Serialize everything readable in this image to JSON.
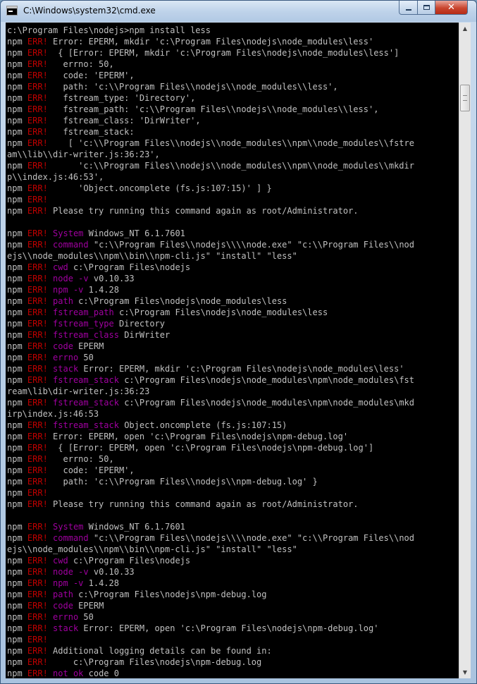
{
  "window": {
    "title": "C:\\Windows\\system32\\cmd.exe",
    "icon": "cmd-icon",
    "controls": {
      "minimize": "minimize-icon",
      "maximize": "maximize-icon",
      "close": "✕"
    }
  },
  "colors": {
    "background": "#000000",
    "text": "#c0c0c0",
    "err": "#c00000",
    "key": "#a000a0"
  },
  "console": {
    "lines": [
      [
        [
          "c:\\Program Files\\nodejs>npm install less",
          ""
        ]
      ],
      [
        [
          "npm ",
          ""
        ],
        [
          "ERR!",
          "r"
        ],
        [
          " Error: EPERM, mkdir 'c:\\Program Files\\nodejs\\node_modules\\less'",
          ""
        ]
      ],
      [
        [
          "npm ",
          ""
        ],
        [
          "ERR!",
          "r"
        ],
        [
          "  { [Error: EPERM, mkdir 'c:\\Program Files\\nodejs\\node_modules\\less']",
          ""
        ]
      ],
      [
        [
          "npm ",
          ""
        ],
        [
          "ERR!",
          "r"
        ],
        [
          "   errno: 50,",
          ""
        ]
      ],
      [
        [
          "npm ",
          ""
        ],
        [
          "ERR!",
          "r"
        ],
        [
          "   code: 'EPERM',",
          ""
        ]
      ],
      [
        [
          "npm ",
          ""
        ],
        [
          "ERR!",
          "r"
        ],
        [
          "   path: 'c:\\\\Program Files\\\\nodejs\\\\node_modules\\\\less',",
          ""
        ]
      ],
      [
        [
          "npm ",
          ""
        ],
        [
          "ERR!",
          "r"
        ],
        [
          "   fstream_type: 'Directory',",
          ""
        ]
      ],
      [
        [
          "npm ",
          ""
        ],
        [
          "ERR!",
          "r"
        ],
        [
          "   fstream_path: 'c:\\\\Program Files\\\\nodejs\\\\node_modules\\\\less',",
          ""
        ]
      ],
      [
        [
          "npm ",
          ""
        ],
        [
          "ERR!",
          "r"
        ],
        [
          "   fstream_class: 'DirWriter',",
          ""
        ]
      ],
      [
        [
          "npm ",
          ""
        ],
        [
          "ERR!",
          "r"
        ],
        [
          "   fstream_stack:",
          ""
        ]
      ],
      [
        [
          "npm ",
          ""
        ],
        [
          "ERR!",
          "r"
        ],
        [
          "    [ 'c:\\\\Program Files\\\\nodejs\\\\node_modules\\\\npm\\\\node_modules\\\\fstre",
          ""
        ]
      ],
      [
        [
          "am\\\\lib\\\\dir-writer.js:36:23',",
          ""
        ]
      ],
      [
        [
          "npm ",
          ""
        ],
        [
          "ERR!",
          "r"
        ],
        [
          "      'c:\\\\Program Files\\\\nodejs\\\\node_modules\\\\npm\\\\node_modules\\\\mkdir",
          ""
        ]
      ],
      [
        [
          "p\\\\index.js:46:53',",
          ""
        ]
      ],
      [
        [
          "npm ",
          ""
        ],
        [
          "ERR!",
          "r"
        ],
        [
          "      'Object.oncomplete (fs.js:107:15)' ] }",
          ""
        ]
      ],
      [
        [
          "npm ",
          ""
        ],
        [
          "ERR!",
          "r"
        ]
      ],
      [
        [
          "npm ",
          ""
        ],
        [
          "ERR!",
          "r"
        ],
        [
          " Please try running this command again as root/Administrator.",
          ""
        ]
      ],
      [
        [
          "",
          ""
        ]
      ],
      [
        [
          "npm ",
          ""
        ],
        [
          "ERR!",
          "r"
        ],
        [
          " ",
          ""
        ],
        [
          "System",
          "m"
        ],
        [
          " Windows_NT 6.1.7601",
          ""
        ]
      ],
      [
        [
          "npm ",
          ""
        ],
        [
          "ERR!",
          "r"
        ],
        [
          " ",
          ""
        ],
        [
          "command",
          "m"
        ],
        [
          " \"c:\\\\Program Files\\\\nodejs\\\\\\\\node.exe\" \"c:\\\\Program Files\\\\nod",
          ""
        ]
      ],
      [
        [
          "ejs\\\\node_modules\\\\npm\\\\bin\\\\npm-cli.js\" \"install\" \"less\"",
          ""
        ]
      ],
      [
        [
          "npm ",
          ""
        ],
        [
          "ERR!",
          "r"
        ],
        [
          " ",
          ""
        ],
        [
          "cwd",
          "m"
        ],
        [
          " c:\\Program Files\\nodejs",
          ""
        ]
      ],
      [
        [
          "npm ",
          ""
        ],
        [
          "ERR!",
          "r"
        ],
        [
          " ",
          ""
        ],
        [
          "node -v",
          "m"
        ],
        [
          " v0.10.33",
          ""
        ]
      ],
      [
        [
          "npm ",
          ""
        ],
        [
          "ERR!",
          "r"
        ],
        [
          " ",
          ""
        ],
        [
          "npm -v",
          "m"
        ],
        [
          " 1.4.28",
          ""
        ]
      ],
      [
        [
          "npm ",
          ""
        ],
        [
          "ERR!",
          "r"
        ],
        [
          " ",
          ""
        ],
        [
          "path",
          "m"
        ],
        [
          " c:\\Program Files\\nodejs\\node_modules\\less",
          ""
        ]
      ],
      [
        [
          "npm ",
          ""
        ],
        [
          "ERR!",
          "r"
        ],
        [
          " ",
          ""
        ],
        [
          "fstream_path",
          "m"
        ],
        [
          " c:\\Program Files\\nodejs\\node_modules\\less",
          ""
        ]
      ],
      [
        [
          "npm ",
          ""
        ],
        [
          "ERR!",
          "r"
        ],
        [
          " ",
          ""
        ],
        [
          "fstream_type",
          "m"
        ],
        [
          " Directory",
          ""
        ]
      ],
      [
        [
          "npm ",
          ""
        ],
        [
          "ERR!",
          "r"
        ],
        [
          " ",
          ""
        ],
        [
          "fstream_class",
          "m"
        ],
        [
          " DirWriter",
          ""
        ]
      ],
      [
        [
          "npm ",
          ""
        ],
        [
          "ERR!",
          "r"
        ],
        [
          " ",
          ""
        ],
        [
          "code",
          "m"
        ],
        [
          " EPERM",
          ""
        ]
      ],
      [
        [
          "npm ",
          ""
        ],
        [
          "ERR!",
          "r"
        ],
        [
          " ",
          ""
        ],
        [
          "errno",
          "m"
        ],
        [
          " 50",
          ""
        ]
      ],
      [
        [
          "npm ",
          ""
        ],
        [
          "ERR!",
          "r"
        ],
        [
          " ",
          ""
        ],
        [
          "stack",
          "m"
        ],
        [
          " Error: EPERM, mkdir 'c:\\Program Files\\nodejs\\node_modules\\less'",
          ""
        ]
      ],
      [
        [
          "npm ",
          ""
        ],
        [
          "ERR!",
          "r"
        ],
        [
          " ",
          ""
        ],
        [
          "fstream_stack",
          "m"
        ],
        [
          " c:\\Program Files\\nodejs\\node_modules\\npm\\node_modules\\fst",
          ""
        ]
      ],
      [
        [
          "ream\\lib\\dir-writer.js:36:23",
          ""
        ]
      ],
      [
        [
          "npm ",
          ""
        ],
        [
          "ERR!",
          "r"
        ],
        [
          " ",
          ""
        ],
        [
          "fstream_stack",
          "m"
        ],
        [
          " c:\\Program Files\\nodejs\\node_modules\\npm\\node_modules\\mkd",
          ""
        ]
      ],
      [
        [
          "irp\\index.js:46:53",
          ""
        ]
      ],
      [
        [
          "npm ",
          ""
        ],
        [
          "ERR!",
          "r"
        ],
        [
          " ",
          ""
        ],
        [
          "fstream_stack",
          "m"
        ],
        [
          " Object.oncomplete (fs.js:107:15)",
          ""
        ]
      ],
      [
        [
          "npm ",
          ""
        ],
        [
          "ERR!",
          "r"
        ],
        [
          " Error: EPERM, open 'c:\\Program Files\\nodejs\\npm-debug.log'",
          ""
        ]
      ],
      [
        [
          "npm ",
          ""
        ],
        [
          "ERR!",
          "r"
        ],
        [
          "  { [Error: EPERM, open 'c:\\Program Files\\nodejs\\npm-debug.log']",
          ""
        ]
      ],
      [
        [
          "npm ",
          ""
        ],
        [
          "ERR!",
          "r"
        ],
        [
          "   errno: 50,",
          ""
        ]
      ],
      [
        [
          "npm ",
          ""
        ],
        [
          "ERR!",
          "r"
        ],
        [
          "   code: 'EPERM',",
          ""
        ]
      ],
      [
        [
          "npm ",
          ""
        ],
        [
          "ERR!",
          "r"
        ],
        [
          "   path: 'c:\\\\Program Files\\\\nodejs\\\\npm-debug.log' }",
          ""
        ]
      ],
      [
        [
          "npm ",
          ""
        ],
        [
          "ERR!",
          "r"
        ]
      ],
      [
        [
          "npm ",
          ""
        ],
        [
          "ERR!",
          "r"
        ],
        [
          " Please try running this command again as root/Administrator.",
          ""
        ]
      ],
      [
        [
          "",
          ""
        ]
      ],
      [
        [
          "npm ",
          ""
        ],
        [
          "ERR!",
          "r"
        ],
        [
          " ",
          ""
        ],
        [
          "System",
          "m"
        ],
        [
          " Windows_NT 6.1.7601",
          ""
        ]
      ],
      [
        [
          "npm ",
          ""
        ],
        [
          "ERR!",
          "r"
        ],
        [
          " ",
          ""
        ],
        [
          "command",
          "m"
        ],
        [
          " \"c:\\\\Program Files\\\\nodejs\\\\\\\\node.exe\" \"c:\\\\Program Files\\\\nod",
          ""
        ]
      ],
      [
        [
          "ejs\\\\node_modules\\\\npm\\\\bin\\\\npm-cli.js\" \"install\" \"less\"",
          ""
        ]
      ],
      [
        [
          "npm ",
          ""
        ],
        [
          "ERR!",
          "r"
        ],
        [
          " ",
          ""
        ],
        [
          "cwd",
          "m"
        ],
        [
          " c:\\Program Files\\nodejs",
          ""
        ]
      ],
      [
        [
          "npm ",
          ""
        ],
        [
          "ERR!",
          "r"
        ],
        [
          " ",
          ""
        ],
        [
          "node -v",
          "m"
        ],
        [
          " v0.10.33",
          ""
        ]
      ],
      [
        [
          "npm ",
          ""
        ],
        [
          "ERR!",
          "r"
        ],
        [
          " ",
          ""
        ],
        [
          "npm -v",
          "m"
        ],
        [
          " 1.4.28",
          ""
        ]
      ],
      [
        [
          "npm ",
          ""
        ],
        [
          "ERR!",
          "r"
        ],
        [
          " ",
          ""
        ],
        [
          "path",
          "m"
        ],
        [
          " c:\\Program Files\\nodejs\\npm-debug.log",
          ""
        ]
      ],
      [
        [
          "npm ",
          ""
        ],
        [
          "ERR!",
          "r"
        ],
        [
          " ",
          ""
        ],
        [
          "code",
          "m"
        ],
        [
          " EPERM",
          ""
        ]
      ],
      [
        [
          "npm ",
          ""
        ],
        [
          "ERR!",
          "r"
        ],
        [
          " ",
          ""
        ],
        [
          "errno",
          "m"
        ],
        [
          " 50",
          ""
        ]
      ],
      [
        [
          "npm ",
          ""
        ],
        [
          "ERR!",
          "r"
        ],
        [
          " ",
          ""
        ],
        [
          "stack",
          "m"
        ],
        [
          " Error: EPERM, open 'c:\\Program Files\\nodejs\\npm-debug.log'",
          ""
        ]
      ],
      [
        [
          "npm ",
          ""
        ],
        [
          "ERR!",
          "r"
        ]
      ],
      [
        [
          "npm ",
          ""
        ],
        [
          "ERR!",
          "r"
        ],
        [
          " Additional logging details can be found in:",
          ""
        ]
      ],
      [
        [
          "npm ",
          ""
        ],
        [
          "ERR!",
          "r"
        ],
        [
          "     c:\\Program Files\\nodejs\\npm-debug.log",
          ""
        ]
      ],
      [
        [
          "npm ",
          ""
        ],
        [
          "ERR!",
          "r"
        ],
        [
          " ",
          ""
        ],
        [
          "not ok",
          "m"
        ],
        [
          " code 0",
          ""
        ]
      ]
    ]
  },
  "scrollbar": {
    "up_icon": "▲",
    "down_icon": "▼"
  }
}
